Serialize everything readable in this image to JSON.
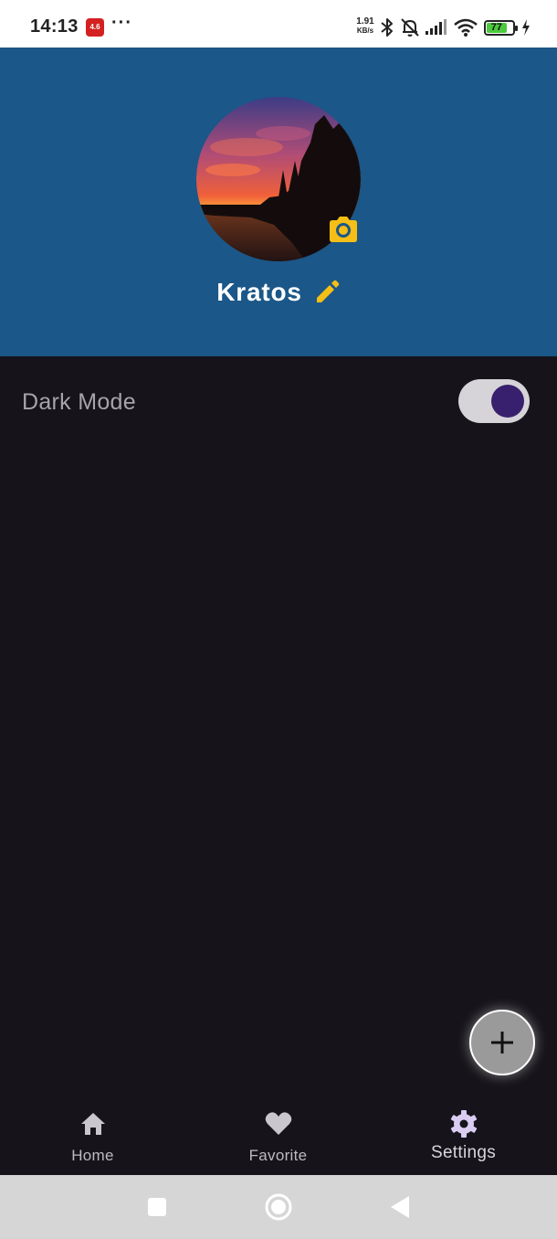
{
  "status_bar": {
    "time": "14:13",
    "app_icon_text": "4.6",
    "more": "···",
    "net_speed_value": "1.91",
    "net_speed_unit": "KB/s",
    "battery_level": "77",
    "icons": [
      "bluetooth-icon",
      "bell-off-icon",
      "signal-icon",
      "wifi-icon",
      "battery-icon",
      "charging-icon"
    ]
  },
  "profile": {
    "name": "Kratos",
    "avatar": "sunset-lake-photo",
    "camera_icon": "camera-icon",
    "edit_icon": "pencil-icon",
    "header_color": "#1b5788",
    "accent_color": "#f5bf16"
  },
  "settings": {
    "dark_mode_label": "Dark Mode",
    "dark_mode_on": true
  },
  "fab": {
    "icon": "plus-icon"
  },
  "bottom_nav": {
    "items": [
      {
        "label": "Home",
        "icon": "home-icon",
        "active": false
      },
      {
        "label": "Favorite",
        "icon": "heart-icon",
        "active": false
      },
      {
        "label": "Settings",
        "icon": "gear-icon",
        "active": true
      }
    ],
    "active_icon_color": "#d9cdf2"
  },
  "system_nav": {
    "buttons": [
      "recents-square-icon",
      "home-circle-icon",
      "back-triangle-icon"
    ]
  }
}
